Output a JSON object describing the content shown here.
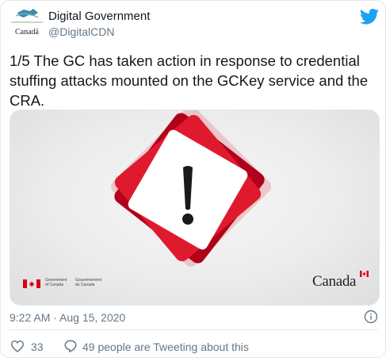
{
  "account": {
    "display_name": "Digital Government",
    "handle": "@DigitalCDN",
    "avatar_caption": "Canadä"
  },
  "tweet": {
    "text": "1/5 The GC has taken action in response to credential stuffing attacks mounted on the GCKey service and the CRA."
  },
  "media": {
    "icon": "warning-exclamation-icon",
    "goc_en_line1": "Government",
    "goc_en_line2": "of Canada",
    "goc_fr_line1": "Gouvernement",
    "goc_fr_line2": "du Canada",
    "wordmark": "Canada"
  },
  "meta": {
    "timestamp": "9:22 AM · Aug 15, 2020"
  },
  "actions": {
    "like_count": "33",
    "reply_text": "49 people are Tweeting about this"
  },
  "colors": {
    "twitter_blue": "#1da1f2",
    "warning_red": "#d6001c",
    "like_red": "#e0245e",
    "muted": "#657786"
  }
}
